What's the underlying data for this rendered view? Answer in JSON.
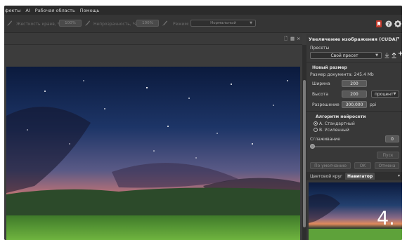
{
  "menu": [
    "фекты",
    "AI",
    "Рабочая область",
    "Помощь"
  ],
  "options": {
    "hardness_label": "Жесткость краев, %",
    "hardness_value": "100%",
    "opacity_label": "Непрозрачность, %",
    "opacity_value": "100%",
    "mode_label": "Режим:",
    "mode_value": "Нормальный"
  },
  "panel": {
    "title": "Увеличение изображения (CUDA)",
    "presets_label": "Пресеты",
    "preset_value": "Свой пресет",
    "new_size_title": "Новый размер",
    "doc_size": "Размер документа: 245.4 Mb",
    "width_label": "Ширина",
    "width_value": "200",
    "height_label": "Высота",
    "height_value": "200",
    "unit_value": "процент",
    "resolution_label": "Разрешение",
    "resolution_value": "300,000",
    "resolution_unit": "ppi",
    "algo_title": "Алгоритм нейросети",
    "algo_a": "A. Стандартный",
    "algo_b": "B. Усиленный",
    "smoothing_label": "Сглаживание",
    "smoothing_value": "0",
    "start_button": "Пуск",
    "default_button": "По умолчанию",
    "ok_button": "OK",
    "cancel_button": "Отмена",
    "tab_color": "Цветовой круг",
    "tab_navigator": "Навигатор"
  },
  "overlay_number": "4.",
  "colors": {
    "accent_red": "#c0392b",
    "panel_bg": "#383838",
    "menu_bg": "#2b2b2b"
  }
}
